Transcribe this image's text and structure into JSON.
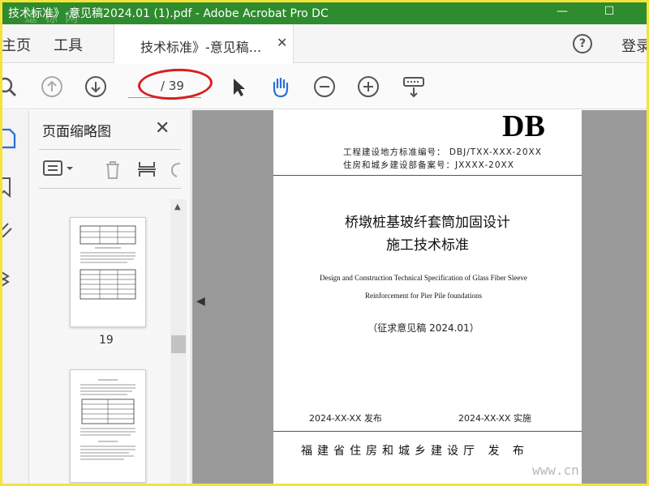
{
  "window": {
    "title": "技术标准》-意见稿2024.01 (1).pdf - Adobe Acrobat Pro DC",
    "watermark": "逗 标 网",
    "minimize_glyph": "—",
    "maximize_glyph": "☐"
  },
  "menu": {
    "home": "主页",
    "tools": "工具",
    "doc_tab": "技术标准》-意见稿...",
    "doc_tab_close": "✕",
    "help": "?",
    "login": "登录"
  },
  "toolbar": {
    "page_indicator": "/ 39"
  },
  "thumbnails": {
    "header": "页面缩略图",
    "close": "✕",
    "page_number": "19"
  },
  "document": {
    "logo": "DB",
    "meta_line1": "工程建设地方标准编号： DBJ/TXX-XXX-20XX",
    "meta_line2": "住房和城乡建设部备案号：JXXXX-20XX",
    "title_line1": "桥墩桩基玻纤套筒加固设计",
    "title_line2": "施工技术标准",
    "en_line1": "Design and Construction Technical Specification of Glass Fiber Sleeve",
    "en_line2": "Reinforcement for Pier Pile foundations",
    "draft": "（征求意见稿 2024.01）",
    "release_date": "2024-XX-XX   发布",
    "effective_date": "2024-XX-XX   实施",
    "issuer": "福建省住房和城乡建设厅 发  布"
  },
  "site_watermark": "www.cn"
}
